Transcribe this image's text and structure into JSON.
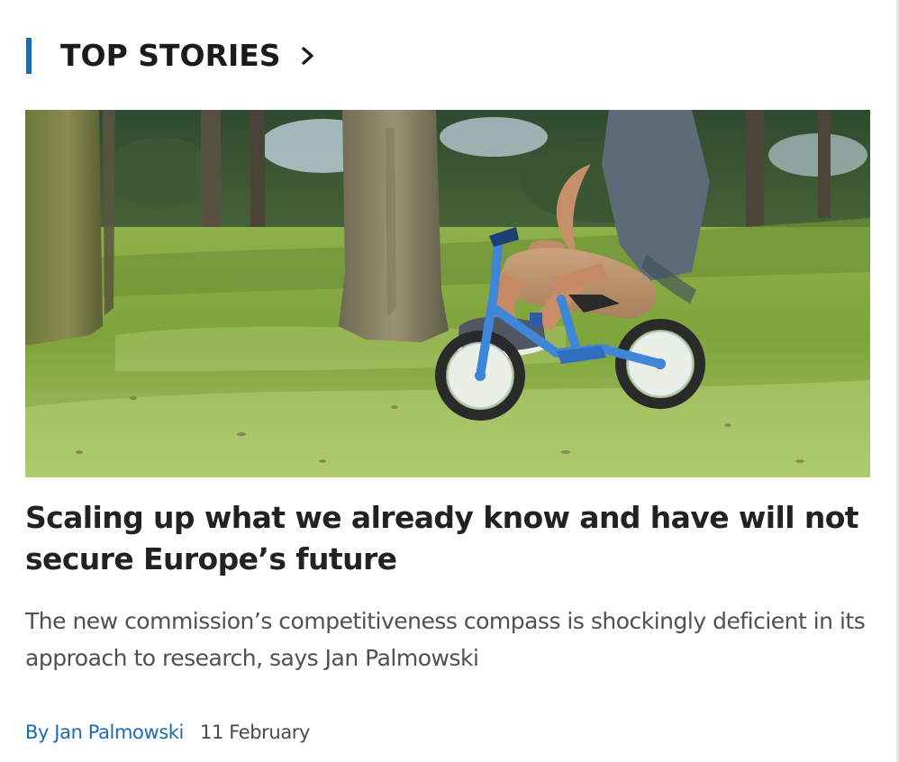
{
  "section": {
    "title": "TOP STORIES",
    "chevron_icon": "chevron-right-icon",
    "accent_color": "#1a6bb5"
  },
  "hero_image": {
    "subject": "person riding a small blue balance bike on grass among trees"
  },
  "article": {
    "headline": "Scaling up what we already know and have will not secure Europe’s future",
    "standfirst": "The new commission’s competitiveness compass is shockingly deficient in its approach to research, says Jan Palmowski",
    "byline": "By Jan Palmowski",
    "date": "11 February",
    "byline_color": "#1a6bb5"
  }
}
